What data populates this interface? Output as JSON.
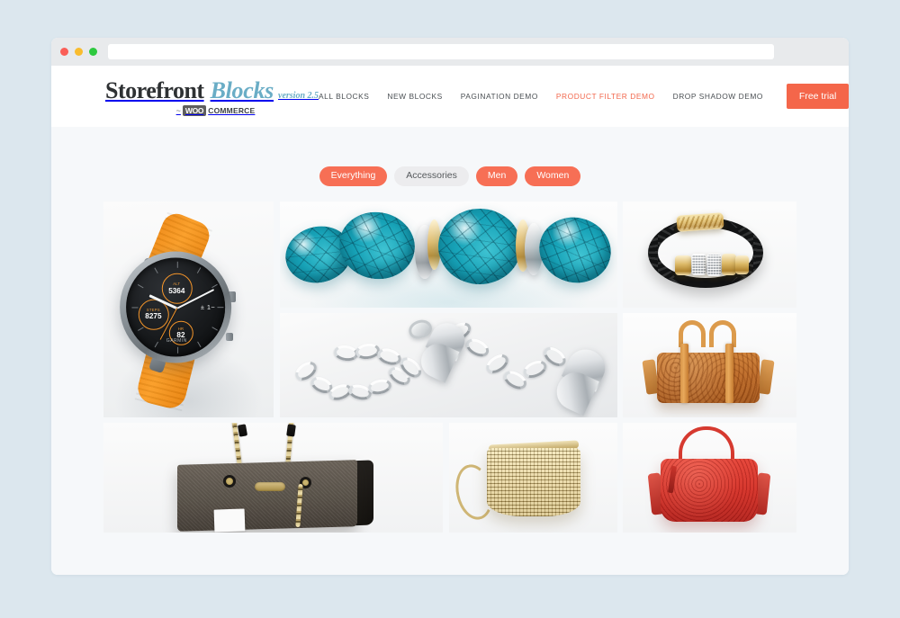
{
  "browser": {
    "url_value": "",
    "url_placeholder": "",
    "traffic_lights": [
      "close",
      "minimize",
      "maximize"
    ]
  },
  "header": {
    "logo": {
      "word_1": "Storefront",
      "word_2": "Blocks",
      "version": "version 2.5",
      "dash": "~",
      "woo": "WOO",
      "commerce": "COMMERCE"
    },
    "nav": [
      {
        "label": "ALL BLOCKS",
        "active": false
      },
      {
        "label": "NEW BLOCKS",
        "active": false
      },
      {
        "label": "PAGINATION DEMO",
        "active": false
      },
      {
        "label": "PRODUCT FILTER DEMO",
        "active": true
      },
      {
        "label": "DROP SHADOW DEMO",
        "active": false
      }
    ],
    "cta_label": "Free trial"
  },
  "filters": [
    {
      "label": "Everything",
      "state": "active"
    },
    {
      "label": "Accessories",
      "state": "inactive"
    },
    {
      "label": "Men",
      "state": "active"
    },
    {
      "label": "Women",
      "state": "active"
    }
  ],
  "products": [
    {
      "name": "garmin-fenix-orange-watch",
      "category": "Men",
      "alt": "ALT",
      "alt_value": "5364",
      "steps": "STEPS",
      "steps_value": "8275",
      "hr": "HR",
      "hr_value": "82",
      "pm": "± 1−",
      "brand": "GARMIN"
    },
    {
      "name": "turquoise-stone-bracelet",
      "category": "Women"
    },
    {
      "name": "black-braided-leather-bracelet",
      "category": "Men"
    },
    {
      "name": "silver-heart-charm-bracelet",
      "category": "Women"
    },
    {
      "name": "tan-leather-bowling-bag",
      "category": "Women"
    },
    {
      "name": "brown-chain-strap-handbag",
      "category": "Women"
    },
    {
      "name": "gold-mesh-clutch-bag",
      "category": "Women"
    },
    {
      "name": "red-leather-hobo-bag",
      "category": "Women"
    }
  ],
  "colors": {
    "accent": "#f4664a",
    "pill_active": "#f76f55",
    "pill_inactive": "#ececee",
    "logo_blue": "#6aadc6",
    "page_bg": "#dce7ee",
    "content_bg": "#f6f8fa"
  }
}
